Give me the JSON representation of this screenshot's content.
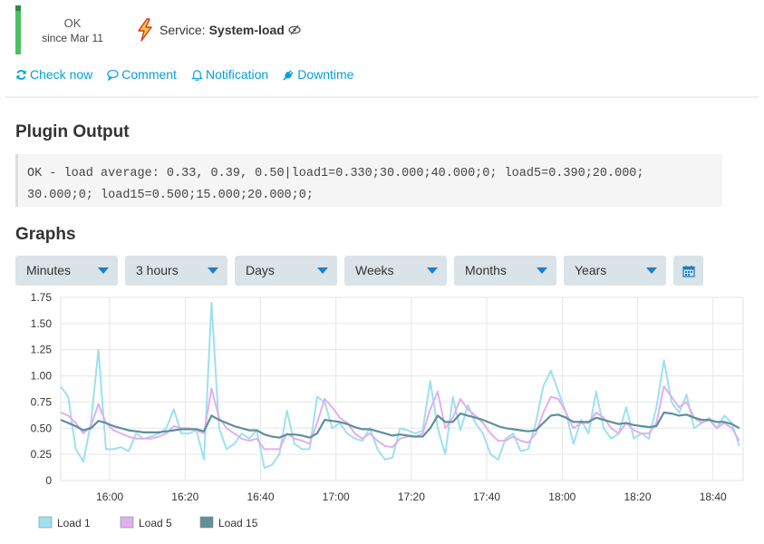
{
  "state": {
    "label": "OK",
    "since": "since Mar 11",
    "color": "#4cbf65"
  },
  "service": {
    "prefix": "Service:",
    "name": "System-load",
    "icon": "lightning-icon"
  },
  "actions": [
    {
      "label": "Check now",
      "icon": "refresh-icon"
    },
    {
      "label": "Comment",
      "icon": "comment-icon"
    },
    {
      "label": "Notification",
      "icon": "bell-icon"
    },
    {
      "label": "Downtime",
      "icon": "plug-icon"
    }
  ],
  "plugin_output": {
    "heading": "Plugin Output",
    "text": "OK - load average: 0.33, 0.39, 0.50|load1=0.330;30.000;40.000;0; load5=0.390;20.000;\n30.000;0; load15=0.500;15.000;20.000;0;"
  },
  "graphs": {
    "heading": "Graphs",
    "selects": [
      "Minutes",
      "3 hours",
      "Days",
      "Weeks",
      "Months",
      "Years"
    ]
  },
  "chart_data": {
    "type": "line",
    "title": "",
    "xlabel": "",
    "ylabel": "",
    "xlim": [
      "15:47",
      "18:48"
    ],
    "ylim": [
      0,
      1.75
    ],
    "yticks": [
      "0",
      "0.25",
      "0.50",
      "0.75",
      "1.00",
      "1.25",
      "1.50",
      "1.75"
    ],
    "xticks": [
      "16:00",
      "16:20",
      "16:40",
      "17:00",
      "17:20",
      "17:40",
      "18:00",
      "18:20",
      "18:40"
    ],
    "grid": true,
    "legend_position": "bottom-left",
    "x": [
      "15:47",
      "15:49",
      "15:51",
      "15:53",
      "15:55",
      "15:57",
      "15:59",
      "16:01",
      "16:03",
      "16:05",
      "16:07",
      "16:09",
      "16:11",
      "16:13",
      "16:15",
      "16:17",
      "16:19",
      "16:21",
      "16:23",
      "16:25",
      "16:27",
      "16:29",
      "16:31",
      "16:33",
      "16:35",
      "16:37",
      "16:39",
      "16:41",
      "16:43",
      "16:45",
      "16:47",
      "16:49",
      "16:51",
      "16:53",
      "16:55",
      "16:57",
      "16:59",
      "17:01",
      "17:03",
      "17:05",
      "17:07",
      "17:09",
      "17:11",
      "17:13",
      "17:15",
      "17:17",
      "17:19",
      "17:21",
      "17:23",
      "17:25",
      "17:27",
      "17:29",
      "17:31",
      "17:33",
      "17:35",
      "17:37",
      "17:39",
      "17:41",
      "17:43",
      "17:45",
      "17:47",
      "17:49",
      "17:51",
      "17:53",
      "17:55",
      "17:57",
      "17:59",
      "18:01",
      "18:03",
      "18:05",
      "18:07",
      "18:09",
      "18:11",
      "18:13",
      "18:15",
      "18:17",
      "18:19",
      "18:21",
      "18:23",
      "18:25",
      "18:27",
      "18:29",
      "18:31",
      "18:33",
      "18:35",
      "18:37",
      "18:39",
      "18:41",
      "18:43",
      "18:45",
      "18:47"
    ],
    "series": [
      {
        "name": "Load 1",
        "color": "#9ee0f0",
        "values": [
          0.9,
          0.8,
          0.3,
          0.18,
          0.55,
          1.25,
          0.3,
          0.3,
          0.32,
          0.28,
          0.45,
          0.4,
          0.42,
          0.45,
          0.5,
          0.68,
          0.45,
          0.45,
          0.48,
          0.2,
          1.7,
          0.5,
          0.3,
          0.35,
          0.45,
          0.4,
          0.48,
          0.12,
          0.15,
          0.25,
          0.67,
          0.35,
          0.3,
          0.3,
          0.8,
          0.75,
          0.5,
          0.55,
          0.45,
          0.4,
          0.38,
          0.5,
          0.3,
          0.2,
          0.22,
          0.5,
          0.48,
          0.45,
          0.48,
          0.95,
          0.5,
          0.25,
          0.8,
          0.48,
          0.72,
          0.55,
          0.45,
          0.25,
          0.2,
          0.4,
          0.45,
          0.28,
          0.3,
          0.55,
          0.9,
          1.05,
          0.85,
          0.65,
          0.35,
          0.58,
          0.45,
          0.85,
          0.5,
          0.4,
          0.45,
          0.7,
          0.4,
          0.45,
          0.4,
          0.7,
          1.15,
          0.75,
          0.65,
          0.82,
          0.5,
          0.55,
          0.6,
          0.5,
          0.62,
          0.55,
          0.33
        ]
      },
      {
        "name": "Load 5",
        "color": "#e0b0ee",
        "values": [
          0.65,
          0.62,
          0.55,
          0.45,
          0.52,
          0.73,
          0.55,
          0.48,
          0.45,
          0.42,
          0.4,
          0.4,
          0.4,
          0.42,
          0.45,
          0.52,
          0.5,
          0.5,
          0.48,
          0.45,
          0.88,
          0.6,
          0.5,
          0.45,
          0.4,
          0.38,
          0.4,
          0.3,
          0.3,
          0.3,
          0.45,
          0.4,
          0.38,
          0.35,
          0.55,
          0.78,
          0.7,
          0.6,
          0.55,
          0.45,
          0.4,
          0.45,
          0.38,
          0.33,
          0.32,
          0.4,
          0.42,
          0.42,
          0.45,
          0.68,
          0.85,
          0.5,
          0.6,
          0.78,
          0.68,
          0.62,
          0.55,
          0.45,
          0.38,
          0.38,
          0.42,
          0.38,
          0.36,
          0.45,
          0.65,
          0.8,
          0.78,
          0.65,
          0.5,
          0.55,
          0.55,
          0.65,
          0.6,
          0.5,
          0.45,
          0.55,
          0.48,
          0.45,
          0.45,
          0.55,
          0.9,
          0.8,
          0.7,
          0.75,
          0.6,
          0.55,
          0.58,
          0.5,
          0.55,
          0.5,
          0.38
        ]
      },
      {
        "name": "Load 15",
        "color": "#5f8f9a",
        "values": [
          0.58,
          0.55,
          0.52,
          0.48,
          0.5,
          0.57,
          0.55,
          0.52,
          0.5,
          0.48,
          0.47,
          0.46,
          0.46,
          0.46,
          0.47,
          0.48,
          0.49,
          0.49,
          0.49,
          0.47,
          0.62,
          0.58,
          0.55,
          0.52,
          0.5,
          0.48,
          0.48,
          0.44,
          0.42,
          0.41,
          0.44,
          0.44,
          0.43,
          0.41,
          0.45,
          0.58,
          0.57,
          0.56,
          0.54,
          0.51,
          0.49,
          0.49,
          0.47,
          0.45,
          0.43,
          0.44,
          0.43,
          0.42,
          0.42,
          0.5,
          0.62,
          0.56,
          0.56,
          0.64,
          0.62,
          0.6,
          0.58,
          0.55,
          0.52,
          0.5,
          0.49,
          0.48,
          0.47,
          0.48,
          0.55,
          0.62,
          0.63,
          0.6,
          0.56,
          0.56,
          0.56,
          0.6,
          0.58,
          0.56,
          0.54,
          0.55,
          0.53,
          0.52,
          0.51,
          0.52,
          0.65,
          0.64,
          0.62,
          0.63,
          0.6,
          0.58,
          0.58,
          0.56,
          0.56,
          0.54,
          0.5
        ]
      }
    ]
  }
}
